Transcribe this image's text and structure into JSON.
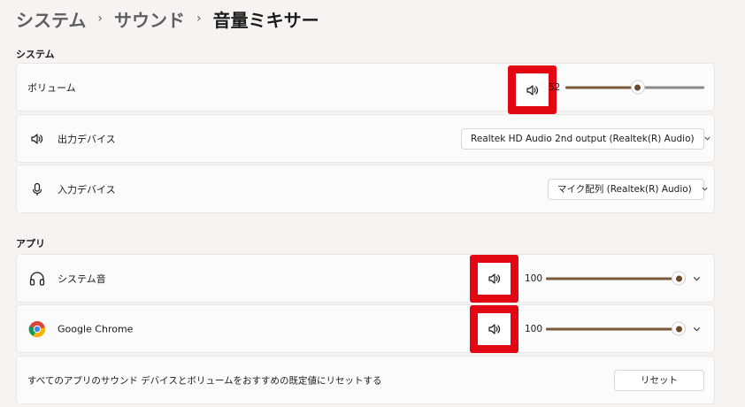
{
  "breadcrumb": {
    "level1": "システム",
    "level2": "サウンド",
    "current": "音量ミキサー",
    "separator": "›"
  },
  "system_section": {
    "title": "システム",
    "volume": {
      "label": "ボリューム",
      "value_text": "52",
      "level": 0.52,
      "icon": "speaker-icon"
    },
    "output": {
      "label": "出力デバイス",
      "selected": "Realtek HD Audio 2nd output (Realtek(R) Audio)",
      "icon": "speaker-icon"
    },
    "input": {
      "label": "入力デバイス",
      "selected": "マイク配列 (Realtek(R) Audio)",
      "icon": "microphone-icon"
    }
  },
  "apps_section": {
    "title": "アプリ",
    "apps": [
      {
        "name": "システム音",
        "volume_text": "100",
        "level": 1.0,
        "icon": "headphones-icon"
      },
      {
        "name": "Google Chrome",
        "volume_text": "100",
        "level": 1.0,
        "icon": "chrome-icon"
      }
    ],
    "reset_text": "すべてのアプリのサウンド デバイスとボリュームをおすすめの既定値にリセットする",
    "reset_button": "リセット"
  },
  "colors": {
    "highlight": "#e30613",
    "slider_fill": "#7a5a3a",
    "background": "#f6f3f1"
  }
}
